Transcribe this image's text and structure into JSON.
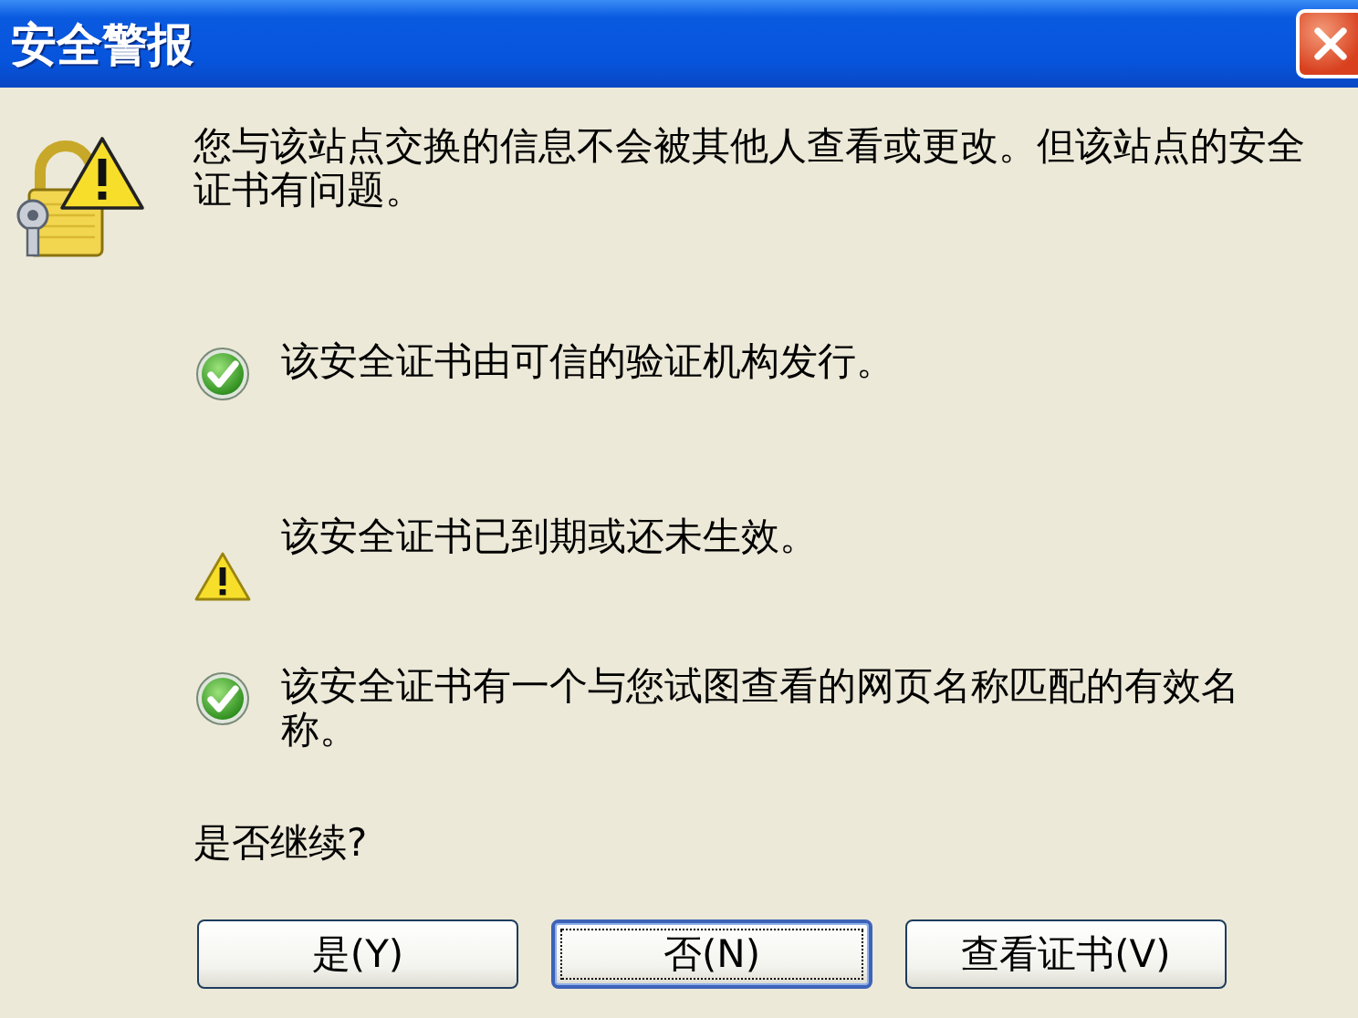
{
  "window": {
    "title": "安全警报"
  },
  "message": "您与该站点交换的信息不会被其他人查看或更改。但该站点的安全证书有问题。",
  "checks": [
    {
      "kind": "ok",
      "text": "该安全证书由可信的验证机构发行。"
    },
    {
      "kind": "warning",
      "text": "该安全证书已到期或还未生效。"
    },
    {
      "kind": "ok",
      "text": "该安全证书有一个与您试图查看的网页名称匹配的有效名称。"
    }
  ],
  "question": "是否继续?",
  "buttons": [
    {
      "label": "是(Y)",
      "default": false
    },
    {
      "label": "否(N)",
      "default": true
    },
    {
      "label": "查看证书(V)",
      "default": false
    }
  ]
}
